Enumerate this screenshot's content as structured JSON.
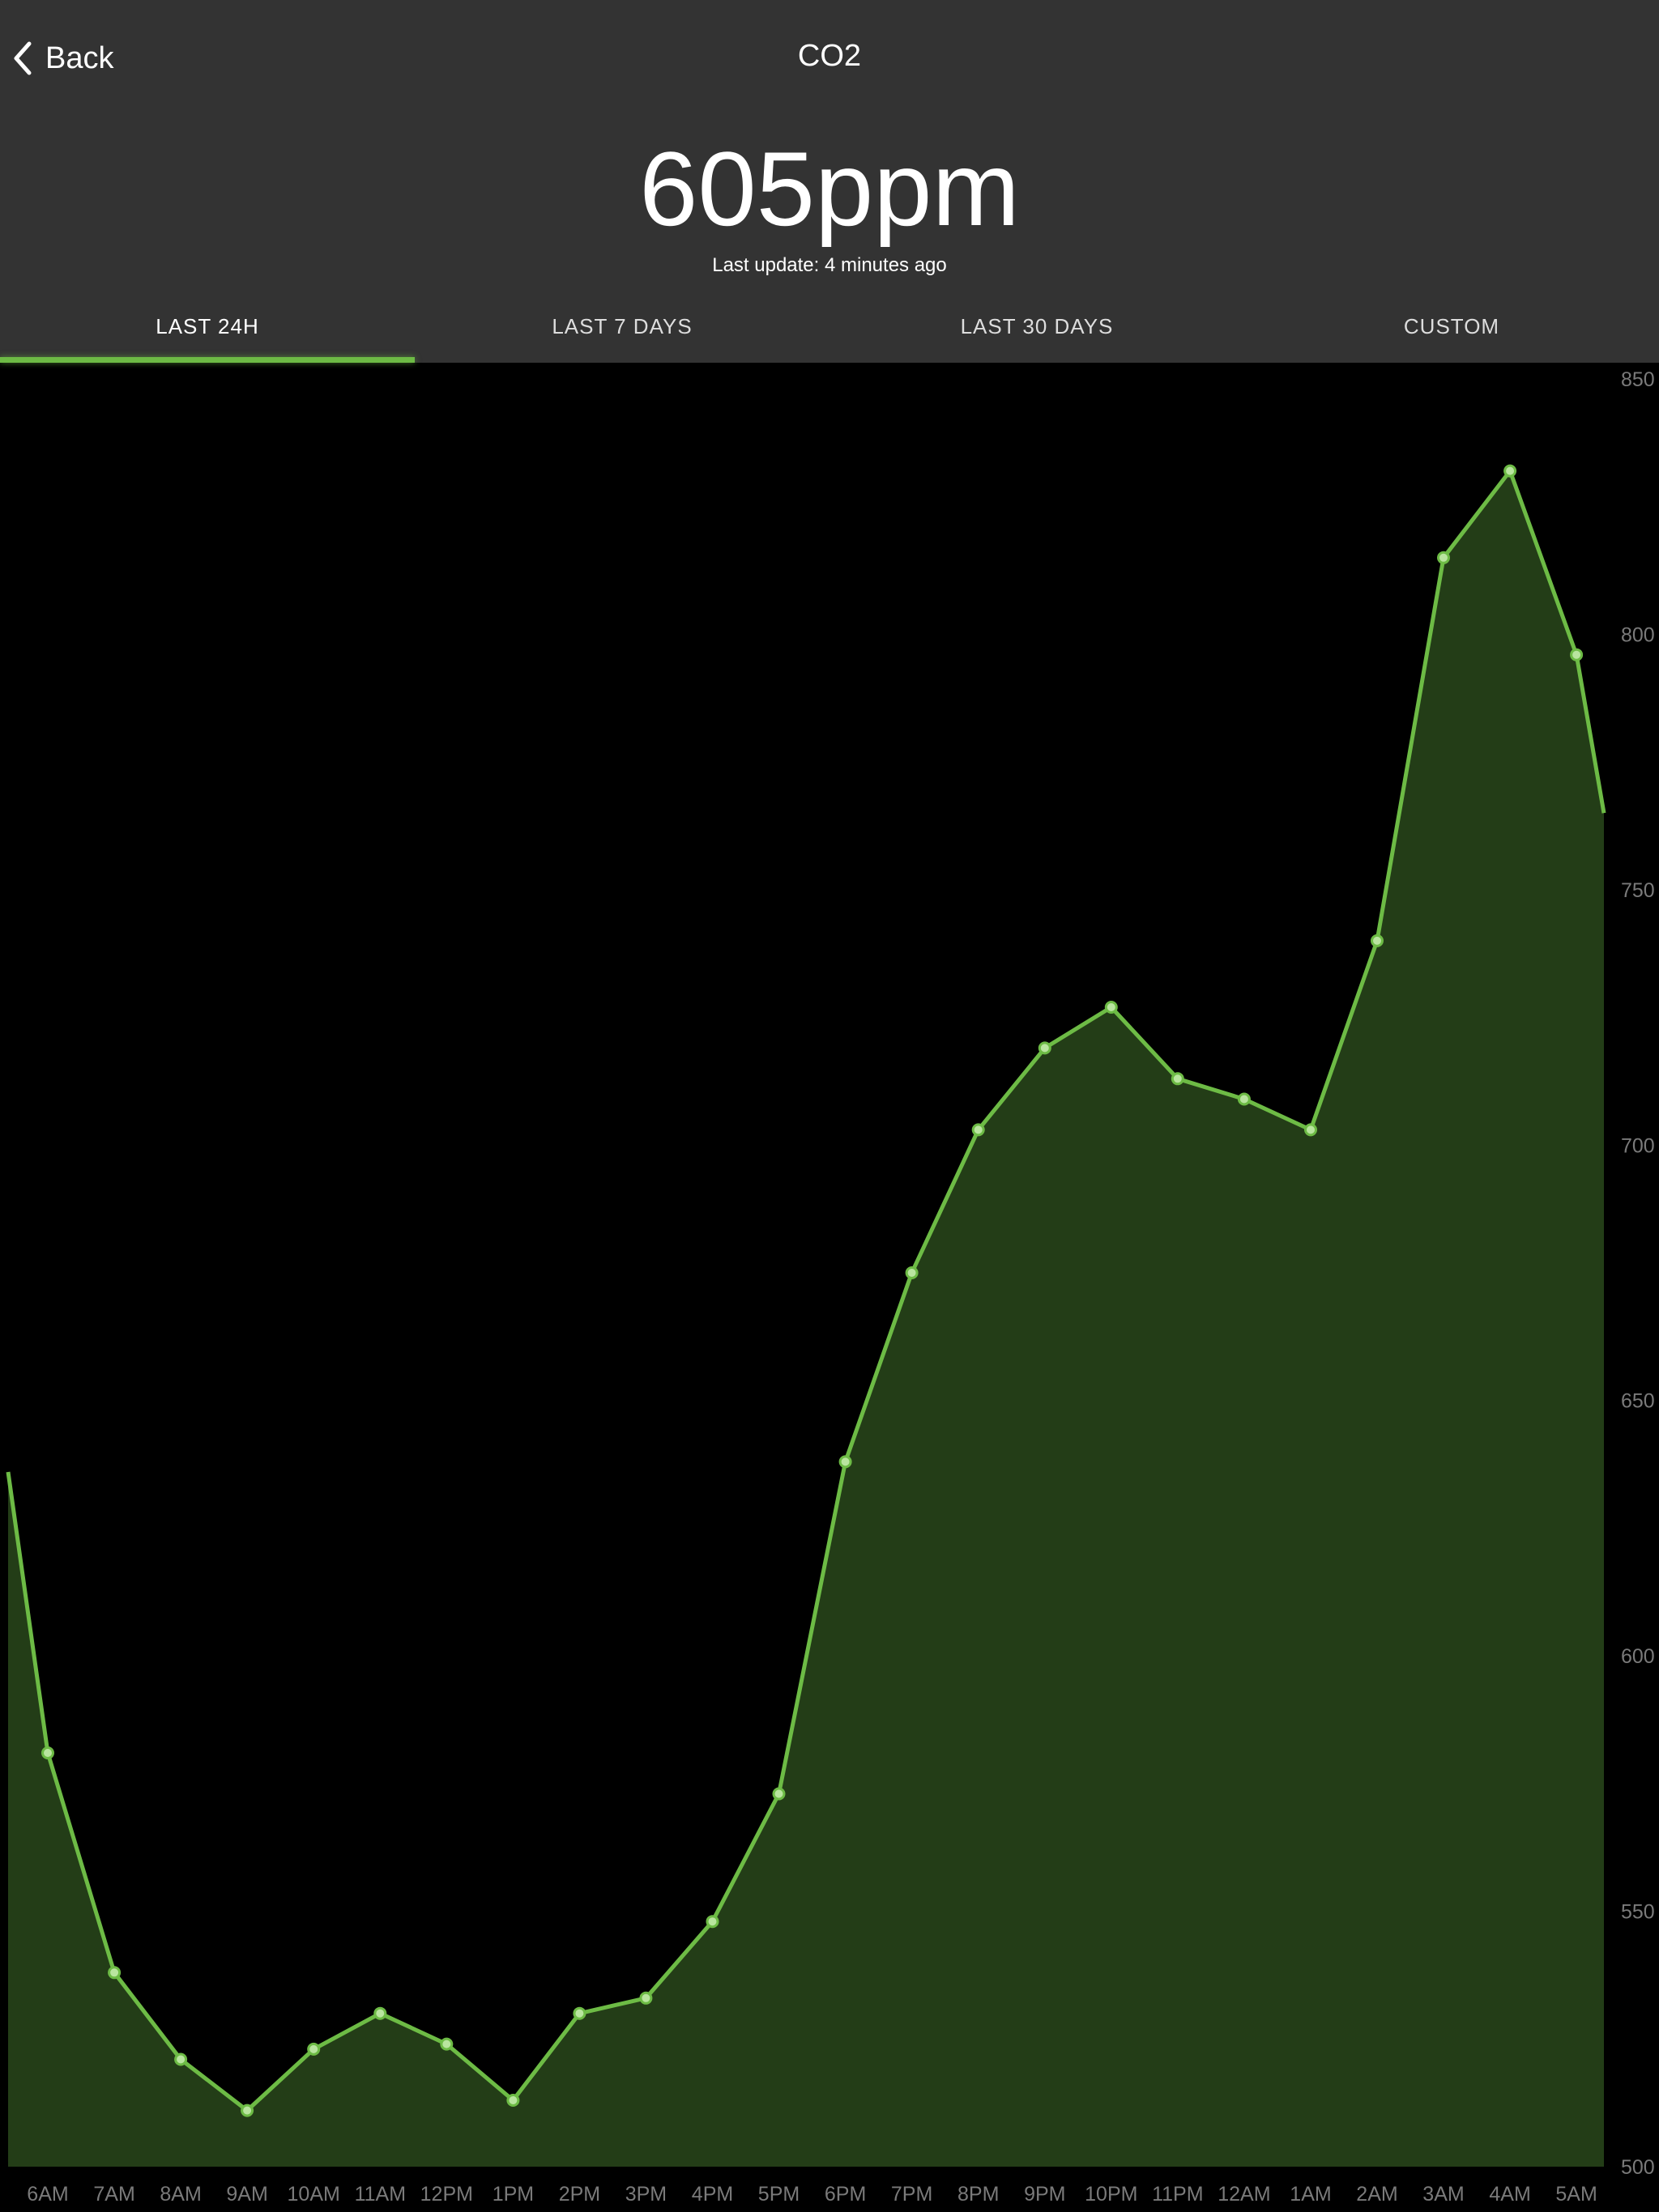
{
  "header": {
    "back_label": "Back",
    "title": "CO2",
    "reading": "605ppm",
    "last_update": "Last update: 4 minutes ago"
  },
  "tabs": [
    {
      "label": "LAST 24H",
      "active": true
    },
    {
      "label": "LAST 7 DAYS",
      "active": false
    },
    {
      "label": "LAST 30 DAYS",
      "active": false
    },
    {
      "label": "CUSTOM",
      "active": false
    }
  ],
  "colors": {
    "header_bg": "#333333",
    "accent": "#6dbb45",
    "area_fill": "#233d17",
    "marker_fill": "#b9e59f",
    "axis_label": "#7a7a7a"
  },
  "icons": {
    "back": "chevron-left-icon"
  },
  "chart_data": {
    "type": "area",
    "title": "",
    "xlabel": "",
    "ylabel": "",
    "ylim": [
      500,
      850
    ],
    "y_ticks": [
      850,
      800,
      750,
      700,
      650,
      600,
      550,
      500
    ],
    "x_ticks": [
      "6AM",
      "7AM",
      "8AM",
      "9AM",
      "10AM",
      "11AM",
      "12PM",
      "1PM",
      "2PM",
      "3PM",
      "4PM",
      "5PM",
      "6PM",
      "7PM",
      "8PM",
      "9PM",
      "10PM",
      "11PM",
      "12AM",
      "1AM",
      "2AM",
      "3AM",
      "4AM",
      "5AM"
    ],
    "grid": false,
    "series": [
      {
        "values": [
          581,
          538,
          521,
          511,
          523,
          530,
          524,
          513,
          530,
          533,
          548,
          573,
          638,
          675,
          703,
          719,
          727,
          713,
          709,
          703,
          740,
          815,
          832,
          796
        ]
      }
    ],
    "start_value": 636,
    "end_value": 765
  }
}
